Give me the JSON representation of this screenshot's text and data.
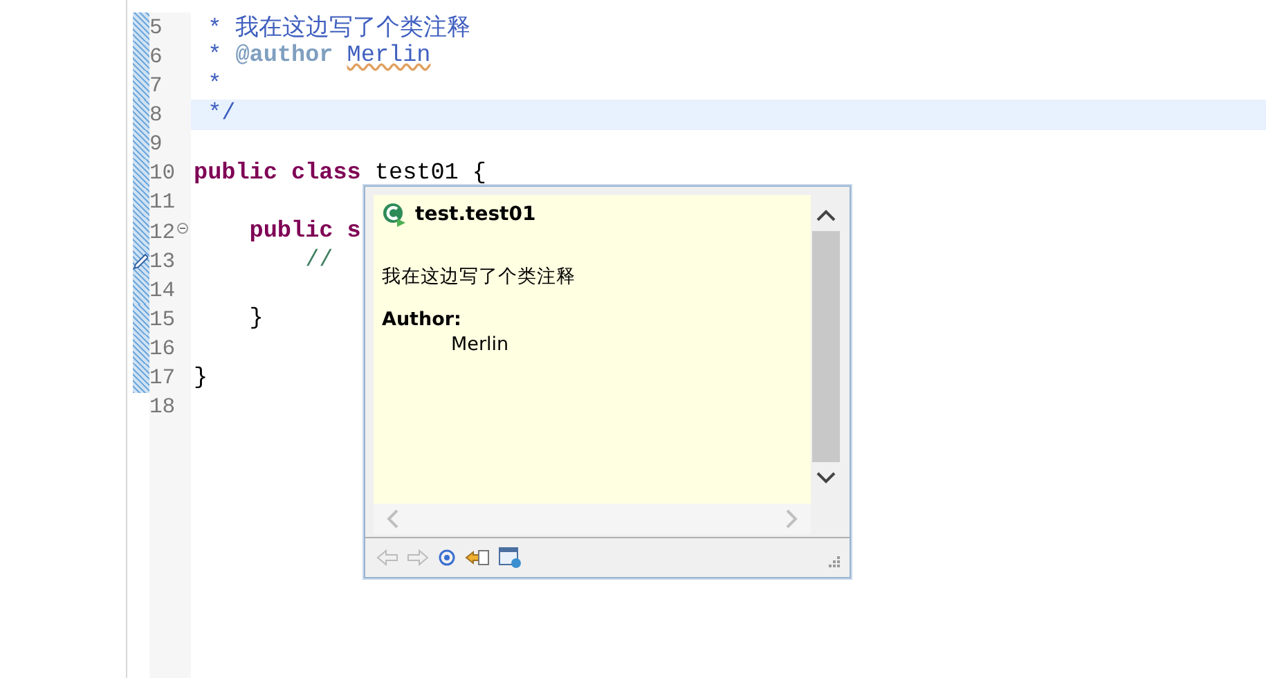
{
  "editor": {
    "lines": [
      {
        "number": "5",
        "current": false,
        "changed": true,
        "fold": false,
        "assist": false,
        "segments": [
          {
            "kind": "doc",
            "text": " * 我在这边写了个类注释"
          }
        ]
      },
      {
        "number": "6",
        "current": false,
        "changed": true,
        "fold": false,
        "assist": false,
        "segments": [
          {
            "kind": "doc",
            "text": " *"
          },
          {
            "kind": "tag",
            "text": " @author "
          },
          {
            "kind": "doc-flagged",
            "text": "Merlin"
          }
        ]
      },
      {
        "number": "7",
        "current": false,
        "changed": true,
        "fold": false,
        "assist": false,
        "segments": [
          {
            "kind": "doc",
            "text": " *"
          }
        ]
      },
      {
        "number": "8",
        "current": true,
        "changed": true,
        "fold": false,
        "assist": false,
        "segments": [
          {
            "kind": "doc",
            "text": " */"
          }
        ]
      },
      {
        "number": "9",
        "current": false,
        "changed": true,
        "fold": false,
        "assist": false
      },
      {
        "number": "10",
        "current": false,
        "changed": true,
        "fold": false,
        "assist": false,
        "segments": [
          {
            "kind": "keyword",
            "text": "public class"
          },
          {
            "kind": "plain",
            "text": " test01 {"
          }
        ]
      },
      {
        "number": "11",
        "current": false,
        "changed": true,
        "fold": false,
        "assist": false
      },
      {
        "number": "12",
        "current": false,
        "changed": true,
        "fold": true,
        "assist": false,
        "segments": [
          {
            "kind": "keyword",
            "text": "    public s"
          }
        ]
      },
      {
        "number": "13",
        "current": false,
        "changed": true,
        "fold": false,
        "assist": true,
        "segments": [
          {
            "kind": "comment",
            "text": "        //"
          }
        ]
      },
      {
        "number": "14",
        "current": false,
        "changed": true,
        "fold": false,
        "assist": false
      },
      {
        "number": "15",
        "current": false,
        "changed": true,
        "fold": false,
        "assist": false,
        "segments": [
          {
            "kind": "plain",
            "text": "    }"
          }
        ]
      },
      {
        "number": "16",
        "current": false,
        "changed": true,
        "fold": false,
        "assist": false
      },
      {
        "number": "17",
        "current": false,
        "changed": true,
        "fold": false,
        "assist": false,
        "segments": [
          {
            "kind": "plain",
            "text": "}"
          }
        ]
      },
      {
        "number": "18",
        "current": false,
        "changed": false,
        "fold": false,
        "assist": false
      }
    ]
  },
  "hover": {
    "title": "test.test01",
    "description": "我在这边写了个类注释",
    "author_label": "Author:",
    "author": "Merlin"
  }
}
